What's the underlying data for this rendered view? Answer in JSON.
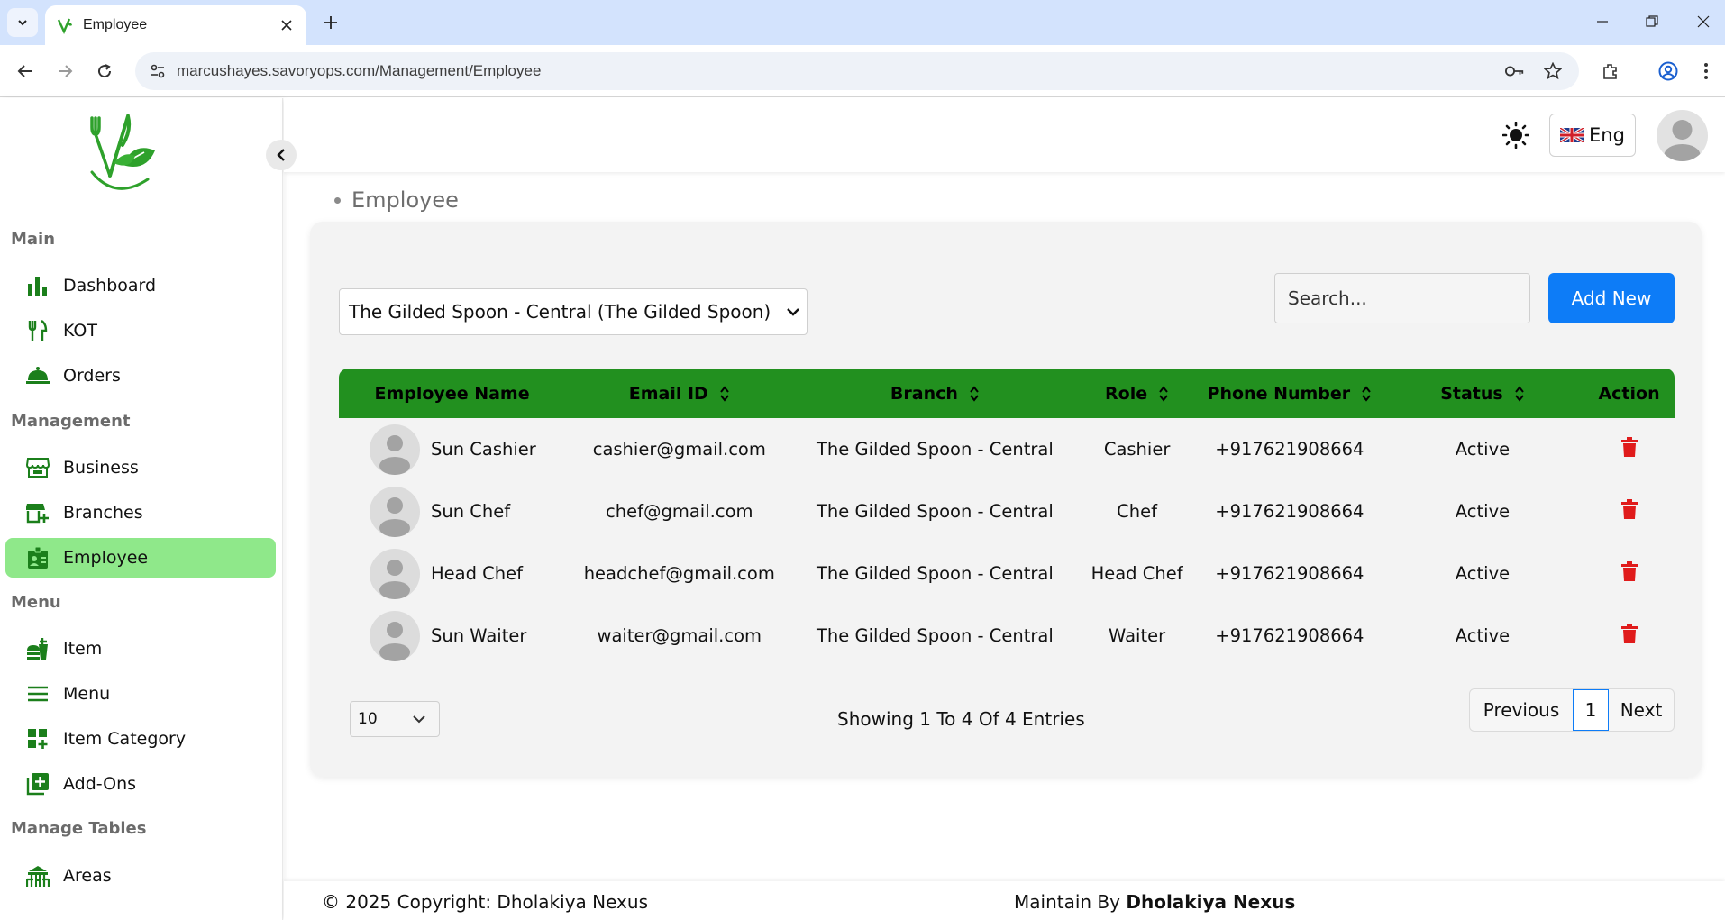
{
  "browser": {
    "tab_title": "Employee",
    "url": "marcushayes.savoryops.com/Management/Employee"
  },
  "sidebar": {
    "sections": {
      "main": "Main",
      "management": "Management",
      "menu": "Menu",
      "manage_tables": "Manage Tables"
    },
    "items": {
      "dashboard": "Dashboard",
      "kot": "KOT",
      "orders": "Orders",
      "business": "Business",
      "branches": "Branches",
      "employee": "Employee",
      "item": "Item",
      "menu": "Menu",
      "item_category": "Item Category",
      "add_ons": "Add-Ons",
      "areas": "Areas"
    },
    "active_item": "Employee",
    "accent_color": "#8fe88a"
  },
  "header": {
    "language": "Eng"
  },
  "breadcrumb": {
    "current": "Employee"
  },
  "controls": {
    "branch_select": "The Gilded Spoon - Central (The Gilded Spoon)",
    "search_placeholder": "Search...",
    "add_button": "Add New",
    "add_button_color": "#0d7cf7"
  },
  "table": {
    "header_color": "#22901f",
    "columns": [
      "Employee Name",
      "Email ID",
      "Branch",
      "Role",
      "Phone Number",
      "Status",
      "Action"
    ],
    "rows": [
      {
        "name": "Sun Cashier",
        "email": "cashier@gmail.com",
        "branch": "The Gilded Spoon - Central",
        "role": "Cashier",
        "phone": "+917621908664",
        "status": "Active"
      },
      {
        "name": "Sun Chef",
        "email": "chef@gmail.com",
        "branch": "The Gilded Spoon - Central",
        "role": "Chef",
        "phone": "+917621908664",
        "status": "Active"
      },
      {
        "name": "Head Chef",
        "email": "headchef@gmail.com",
        "branch": "The Gilded Spoon - Central",
        "role": "Head Chef",
        "phone": "+917621908664",
        "status": "Active"
      },
      {
        "name": "Sun Waiter",
        "email": "waiter@gmail.com",
        "branch": "The Gilded Spoon - Central",
        "role": "Waiter",
        "phone": "+917621908664",
        "status": "Active"
      }
    ]
  },
  "pagination": {
    "page_size": "10",
    "info": "Showing 1 To 4 Of 4 Entries",
    "previous": "Previous",
    "current_page": "1",
    "next": "Next"
  },
  "footer": {
    "copyright": "© 2025 Copyright: Dholakiya Nexus",
    "maintain_prefix": "Maintain By",
    "maintain_name": "Dholakiya Nexus"
  }
}
